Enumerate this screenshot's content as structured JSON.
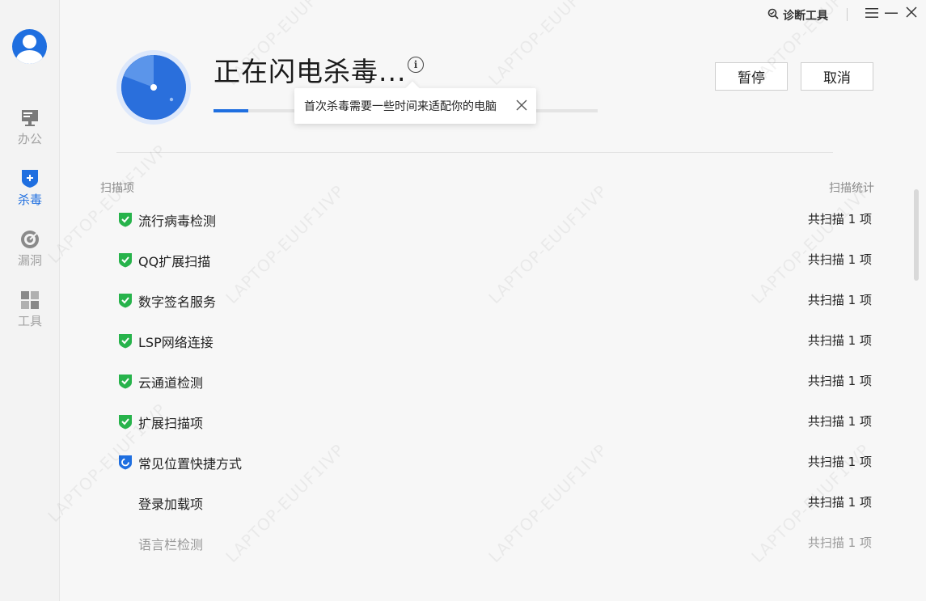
{
  "sidebar": {
    "items": [
      {
        "label": "办公",
        "icon": "monitor-icon"
      },
      {
        "label": "杀毒",
        "icon": "shield-plus-icon",
        "active": true
      },
      {
        "label": "漏洞",
        "icon": "radar-icon"
      },
      {
        "label": "工具",
        "icon": "grid-icon"
      }
    ]
  },
  "topbar": {
    "diag_label": "诊断工具"
  },
  "scan": {
    "title": "正在闪电杀毒...",
    "info_glyph": "i",
    "progress": 0.09,
    "tooltip": "首次杀毒需要一些时间来适配你的电脑",
    "pause_label": "暂停",
    "cancel_label": "取消"
  },
  "table": {
    "col_item": "扫描项",
    "col_stat": "扫描统计",
    "rows": [
      {
        "name": "流行病毒检测",
        "stat": "共扫描 1 项",
        "status": "done"
      },
      {
        "name": "QQ扩展扫描",
        "stat": "共扫描 1 项",
        "status": "done"
      },
      {
        "name": "数字签名服务",
        "stat": "共扫描 1 项",
        "status": "done"
      },
      {
        "name": "LSP网络连接",
        "stat": "共扫描 1 项",
        "status": "done"
      },
      {
        "name": "云通道检测",
        "stat": "共扫描 1 项",
        "status": "done"
      },
      {
        "name": "扩展扫描项",
        "stat": "共扫描 1 项",
        "status": "done"
      },
      {
        "name": "常见位置快捷方式",
        "stat": "共扫描 1 项",
        "status": "scanning"
      },
      {
        "name": "登录加载项",
        "stat": "共扫描 1 项",
        "status": "none"
      },
      {
        "name": "语言栏检测",
        "stat": "共扫描 1 项",
        "status": "dim"
      }
    ]
  },
  "watermark": "LAPTOP-EUUF1IVP",
  "colors": {
    "accent": "#1f6fe0",
    "success": "#27b34b",
    "sidebar_bg": "#f3f3f3",
    "main_bg": "#f7f7f7"
  }
}
